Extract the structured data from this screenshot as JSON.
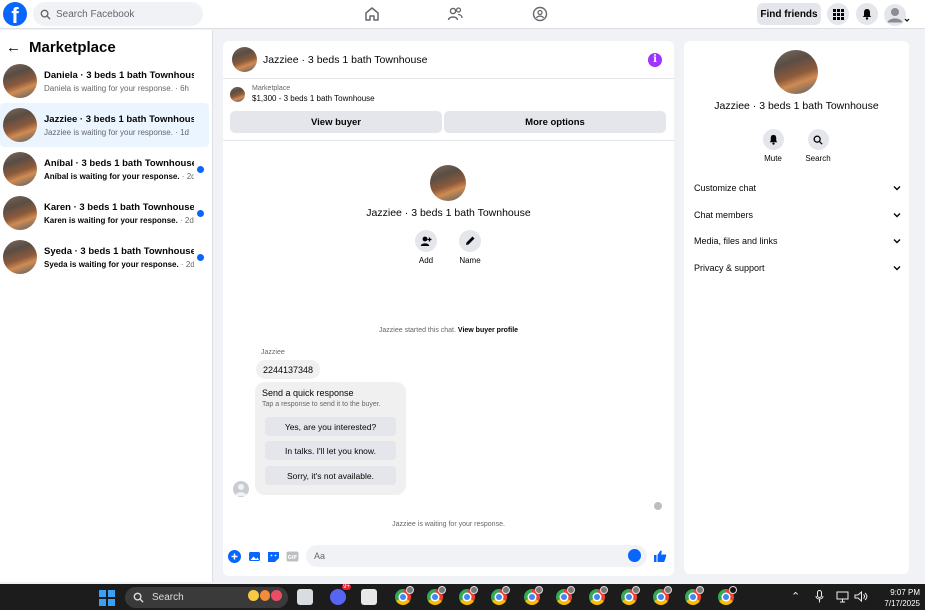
{
  "topbar": {
    "logo": "f",
    "search_placeholder": "Search Facebook",
    "find_friends_label": "Find friends",
    "nav_icons": [
      "home-icon",
      "friends-icon",
      "groups-icon"
    ],
    "right_icons": [
      "menu-grid-icon",
      "bell-icon",
      "account-avatar-icon"
    ]
  },
  "sidebar": {
    "title": "Marketplace",
    "conversations": [
      {
        "title": "Daniela · 3 beds 1 bath Townhouse",
        "subtitle": "Daniela is waiting for your response.",
        "time": " · 6h",
        "unread": false,
        "active": false
      },
      {
        "title": "Jazziee · 3 beds 1 bath Townhouse",
        "subtitle": "Jazziee is waiting for your response.",
        "time": " · 1d",
        "unread": false,
        "active": true
      },
      {
        "title": "Aníbal · 3 beds 1 bath Townhouse",
        "subtitle": "Aníbal is waiting for your response.",
        "time": " · 2d",
        "unread": true,
        "active": false
      },
      {
        "title": "Karen · 3 beds 1 bath Townhouse",
        "subtitle": "Karen is waiting for your response.",
        "time": " · 2d",
        "unread": true,
        "active": false
      },
      {
        "title": "Syeda · 3 beds 1 bath Townhouse",
        "subtitle": "Syeda is waiting for your response.",
        "time": " · 2d",
        "unread": true,
        "active": false
      }
    ]
  },
  "chat": {
    "header_title": "Jazziee · 3 beds 1 bath Townhouse",
    "listing_label": "Marketplace",
    "listing_price": "$1,300 - 3 beds 1 bath Townhouse",
    "view_buyer_label": "View buyer",
    "more_options_label": "More options",
    "center_title": "Jazziee · 3 beds 1 bath Townhouse",
    "add_label": "Add",
    "name_label": "Name",
    "started_text": "Jazziee started this chat.",
    "view_profile_link": "View buyer profile",
    "sender_name": "Jazziee",
    "message_number": "2244137348",
    "quick_title": "Send a quick response",
    "quick_subtitle": "Tap a response to send it to the buyer.",
    "quick_replies": [
      "Yes, are you interested?",
      "In talks. I'll let you know.",
      "Sorry, it's not available."
    ],
    "waiting_text": "Jazziee is waiting for your response.",
    "composer_placeholder": "Aa"
  },
  "details": {
    "title": "Jazziee · 3 beds 1 bath Townhouse",
    "mute_label": "Mute",
    "search_label": "Search",
    "sections": [
      "Customize chat",
      "Chat members",
      "Media, files and links",
      "Privacy & support"
    ]
  },
  "taskbar": {
    "search_label": "Search",
    "time": "9:07 PM",
    "date": "7/17/2025",
    "messenger_badge": "9+"
  },
  "colors": {
    "facebook_blue": "#0866ff",
    "info_purple": "#a033ff",
    "selected_bg": "#ebf5ff"
  }
}
